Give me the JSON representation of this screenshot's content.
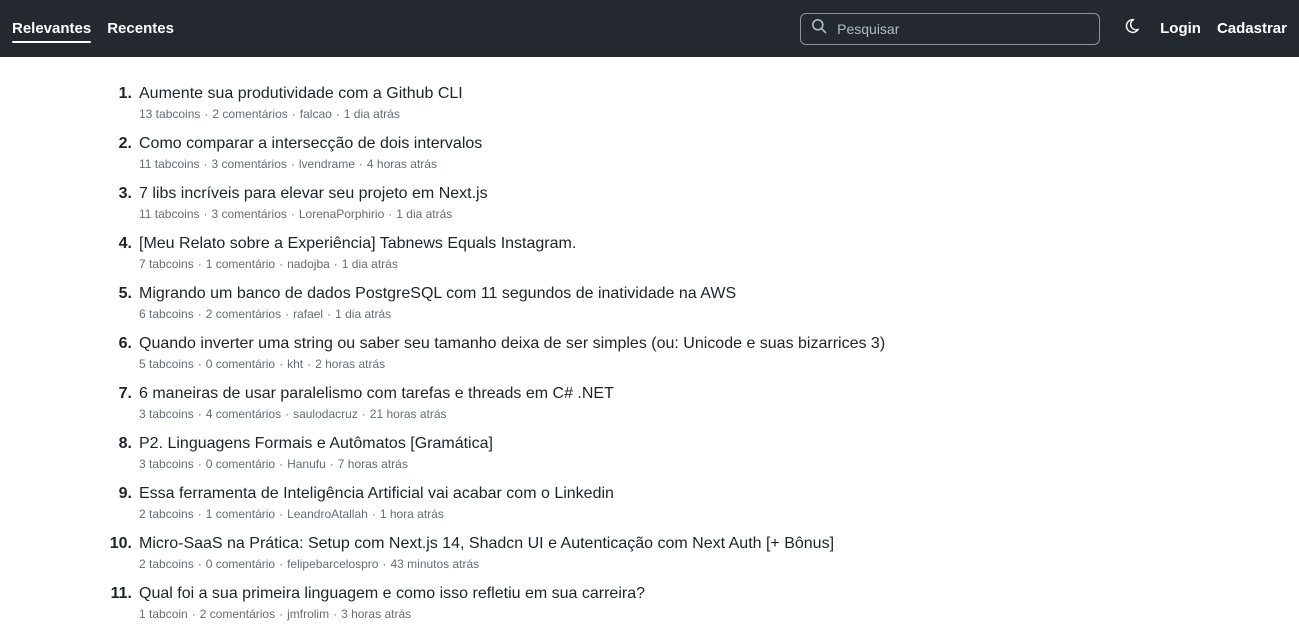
{
  "nav": {
    "tabs": [
      {
        "label": "Relevantes",
        "active": true
      },
      {
        "label": "Recentes",
        "active": false
      }
    ],
    "search_placeholder": "Pesquisar",
    "theme_icon": "moon-icon",
    "login_label": "Login",
    "signup_label": "Cadastrar"
  },
  "posts": [
    {
      "number": "1.",
      "title": "Aumente sua produtividade com a Github CLI",
      "tabcoins": "13 tabcoins",
      "comments": "2 comentários",
      "author": "falcao",
      "time": "1 dia atrás"
    },
    {
      "number": "2.",
      "title": "Como comparar a intersecção de dois intervalos",
      "tabcoins": "11 tabcoins",
      "comments": "3 comentários",
      "author": "lvendrame",
      "time": "4 horas atrás"
    },
    {
      "number": "3.",
      "title": "7 libs incríveis para elevar seu projeto em Next.js",
      "tabcoins": "11 tabcoins",
      "comments": "3 comentários",
      "author": "LorenaPorphirio",
      "time": "1 dia atrás"
    },
    {
      "number": "4.",
      "title": "[Meu Relato sobre a Experiência] Tabnews Equals Instagram.",
      "tabcoins": "7 tabcoins",
      "comments": "1 comentário",
      "author": "nadojba",
      "time": "1 dia atrás"
    },
    {
      "number": "5.",
      "title": "Migrando um banco de dados PostgreSQL com 11 segundos de inatividade na AWS",
      "tabcoins": "6 tabcoins",
      "comments": "2 comentários",
      "author": "rafael",
      "time": "1 dia atrás"
    },
    {
      "number": "6.",
      "title": "Quando inverter uma string ou saber seu tamanho deixa de ser simples (ou: Unicode e suas bizarrices 3)",
      "tabcoins": "5 tabcoins",
      "comments": "0 comentário",
      "author": "kht",
      "time": "2 horas atrás"
    },
    {
      "number": "7.",
      "title": "6 maneiras de usar paralelismo com tarefas e threads em C# .NET",
      "tabcoins": "3 tabcoins",
      "comments": "4 comentários",
      "author": "saulodacruz",
      "time": "21 horas atrás"
    },
    {
      "number": "8.",
      "title": "P2. Linguagens Formais e Autômatos [Gramática]",
      "tabcoins": "3 tabcoins",
      "comments": "0 comentário",
      "author": "Hanufu",
      "time": "7 horas atrás"
    },
    {
      "number": "9.",
      "title": "Essa ferramenta de Inteligência Artificial vai acabar com o Linkedin",
      "tabcoins": "2 tabcoins",
      "comments": "1 comentário",
      "author": "LeandroAtallah",
      "time": "1 hora atrás"
    },
    {
      "number": "10.",
      "title": "Micro-SaaS na Prática: Setup com Next.js 14, Shadcn UI e Autenticação com Next Auth [+ Bônus]",
      "tabcoins": "2 tabcoins",
      "comments": "0 comentário",
      "author": "felipebarcelospro",
      "time": "43 minutos atrás"
    },
    {
      "number": "11.",
      "title": "Qual foi a sua primeira linguagem e como isso refletiu em sua carreira?",
      "tabcoins": "1 tabcoin",
      "comments": "2 comentários",
      "author": "jmfrolim",
      "time": "3 horas atrás"
    }
  ]
}
